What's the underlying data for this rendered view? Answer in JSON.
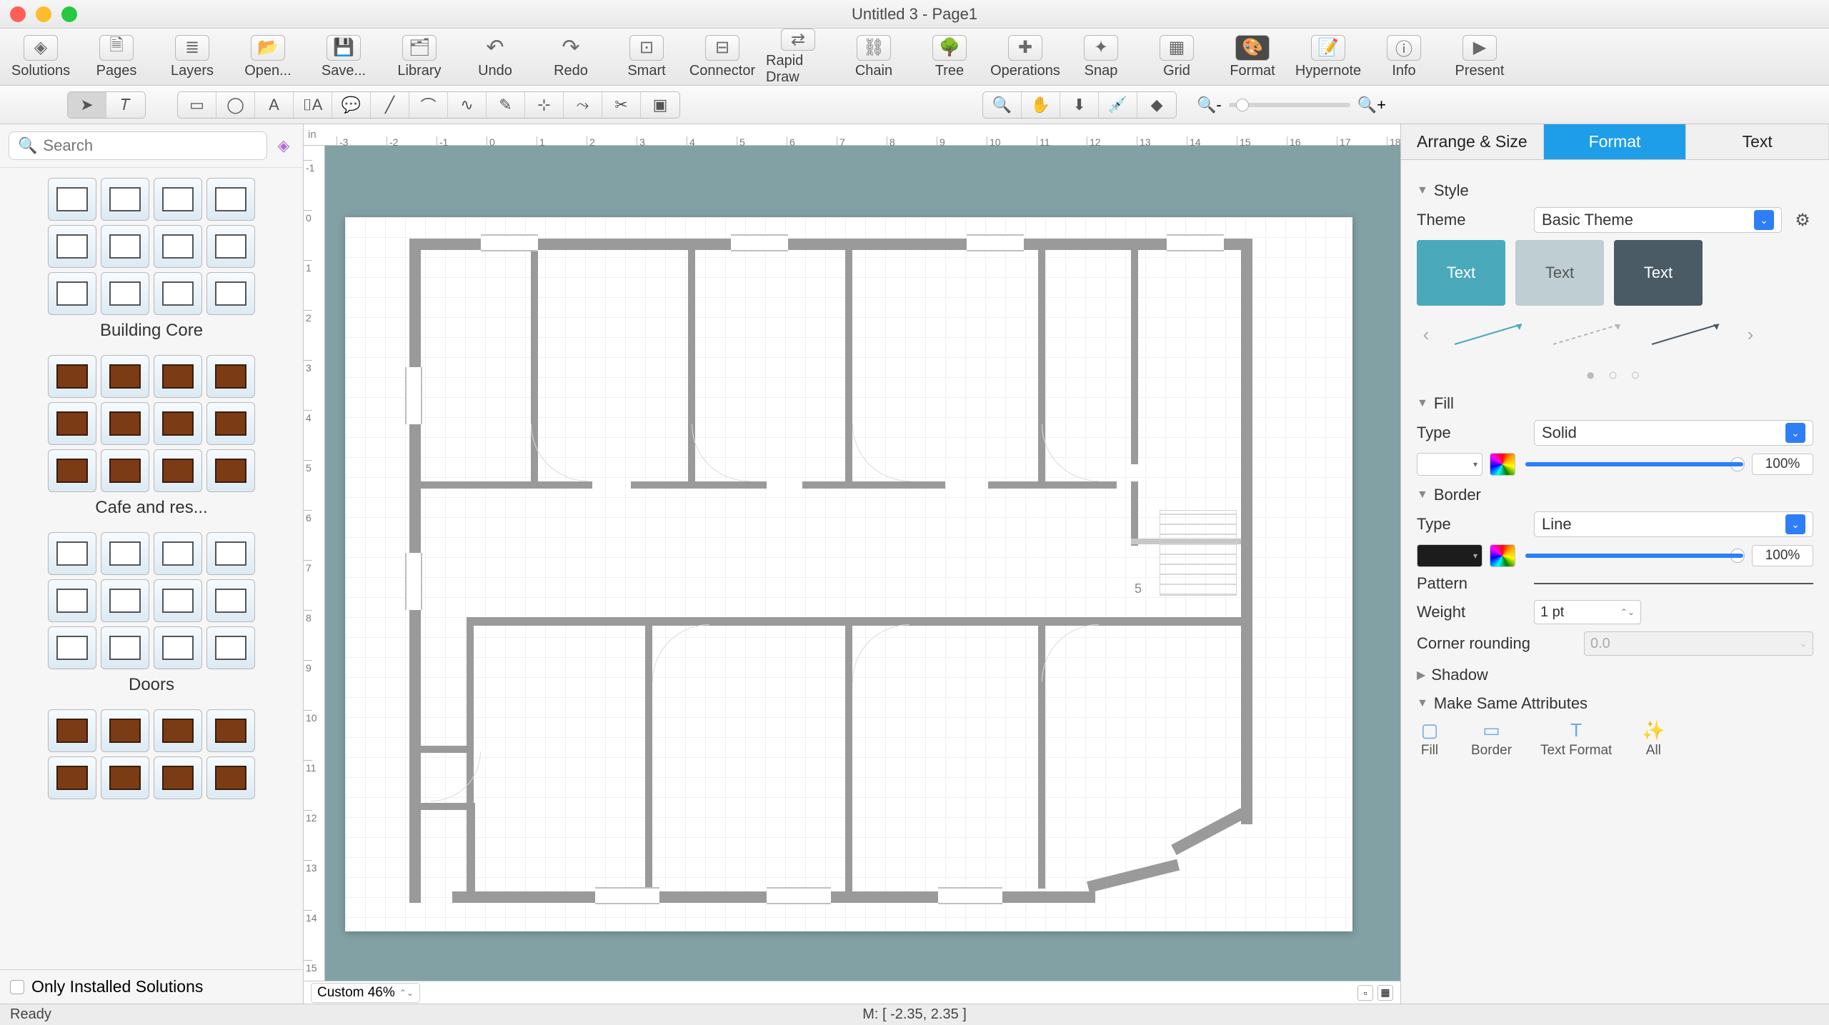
{
  "window": {
    "title": "Untitled 3 - Page1"
  },
  "toolbar": [
    {
      "id": "solutions",
      "label": "Solutions",
      "glyph": "◈"
    },
    {
      "id": "pages",
      "label": "Pages",
      "glyph": "🗎"
    },
    {
      "id": "layers",
      "label": "Layers",
      "glyph": "≣"
    },
    {
      "id": "open",
      "label": "Open...",
      "glyph": "📂"
    },
    {
      "id": "save",
      "label": "Save...",
      "glyph": "💾"
    },
    {
      "id": "library",
      "label": "Library",
      "glyph": "🗂"
    },
    {
      "id": "undo",
      "label": "Undo",
      "glyph": "↶"
    },
    {
      "id": "redo",
      "label": "Redo",
      "glyph": "↷"
    },
    {
      "id": "smart",
      "label": "Smart",
      "glyph": "⊡"
    },
    {
      "id": "connector",
      "label": "Connector",
      "glyph": "⊟"
    },
    {
      "id": "rapid",
      "label": "Rapid Draw",
      "glyph": "⇄"
    },
    {
      "id": "chain",
      "label": "Chain",
      "glyph": "⛓"
    },
    {
      "id": "tree",
      "label": "Tree",
      "glyph": "🌳"
    },
    {
      "id": "operations",
      "label": "Operations",
      "glyph": "✚"
    },
    {
      "id": "snap",
      "label": "Snap",
      "glyph": "✦"
    },
    {
      "id": "grid",
      "label": "Grid",
      "glyph": "▦"
    },
    {
      "id": "format",
      "label": "Format",
      "glyph": "🎨"
    },
    {
      "id": "hypernote",
      "label": "Hypernote",
      "glyph": "📝"
    },
    {
      "id": "info",
      "label": "Info",
      "glyph": "ⓘ"
    },
    {
      "id": "present",
      "label": "Present",
      "glyph": "▶"
    }
  ],
  "search": {
    "placeholder": "Search"
  },
  "library_groups": [
    {
      "name": "Building Core",
      "rows": 3,
      "cols": 4,
      "style": "plain"
    },
    {
      "name": "Cafe and res...",
      "rows": 3,
      "cols": 4,
      "style": "brown"
    },
    {
      "name": "Doors",
      "rows": 3,
      "cols": 4,
      "style": "plain"
    },
    {
      "name": "",
      "rows": 2,
      "cols": 4,
      "style": "brown"
    }
  ],
  "left_footer": {
    "checkbox_label": "Only Installed Solutions"
  },
  "canvas": {
    "zoom_label": "Custom 46%"
  },
  "ruler_h": [
    -3,
    -2,
    -1,
    0,
    1,
    2,
    3,
    4,
    5,
    6,
    7,
    8,
    9,
    10,
    11,
    12,
    13,
    14,
    15,
    16,
    17,
    18
  ],
  "ruler_v": [
    -1,
    0,
    1,
    2,
    3,
    4,
    5,
    6,
    7,
    8,
    9,
    10,
    11,
    12,
    13,
    14,
    15
  ],
  "status": {
    "left": "Ready",
    "mid": "M: [ -2.35, 2.35 ]"
  },
  "inspector": {
    "tabs": [
      "Arrange & Size",
      "Format",
      "Text"
    ],
    "active_tab": 1,
    "style": {
      "header": "Style",
      "theme_label": "Theme",
      "theme_value": "Basic Theme",
      "swatches": [
        "Text",
        "Text",
        "Text"
      ]
    },
    "fill": {
      "header": "Fill",
      "type_label": "Type",
      "type_value": "Solid",
      "opacity": "100%"
    },
    "border": {
      "header": "Border",
      "type_label": "Type",
      "type_value": "Line",
      "opacity": "100%",
      "pattern_label": "Pattern",
      "weight_label": "Weight",
      "weight_value": "1 pt",
      "corner_label": "Corner rounding",
      "corner_value": "0.0"
    },
    "shadow": {
      "header": "Shadow"
    },
    "same": {
      "header": "Make Same Attributes",
      "buttons": [
        "Fill",
        "Border",
        "Text Format",
        "All"
      ]
    }
  }
}
